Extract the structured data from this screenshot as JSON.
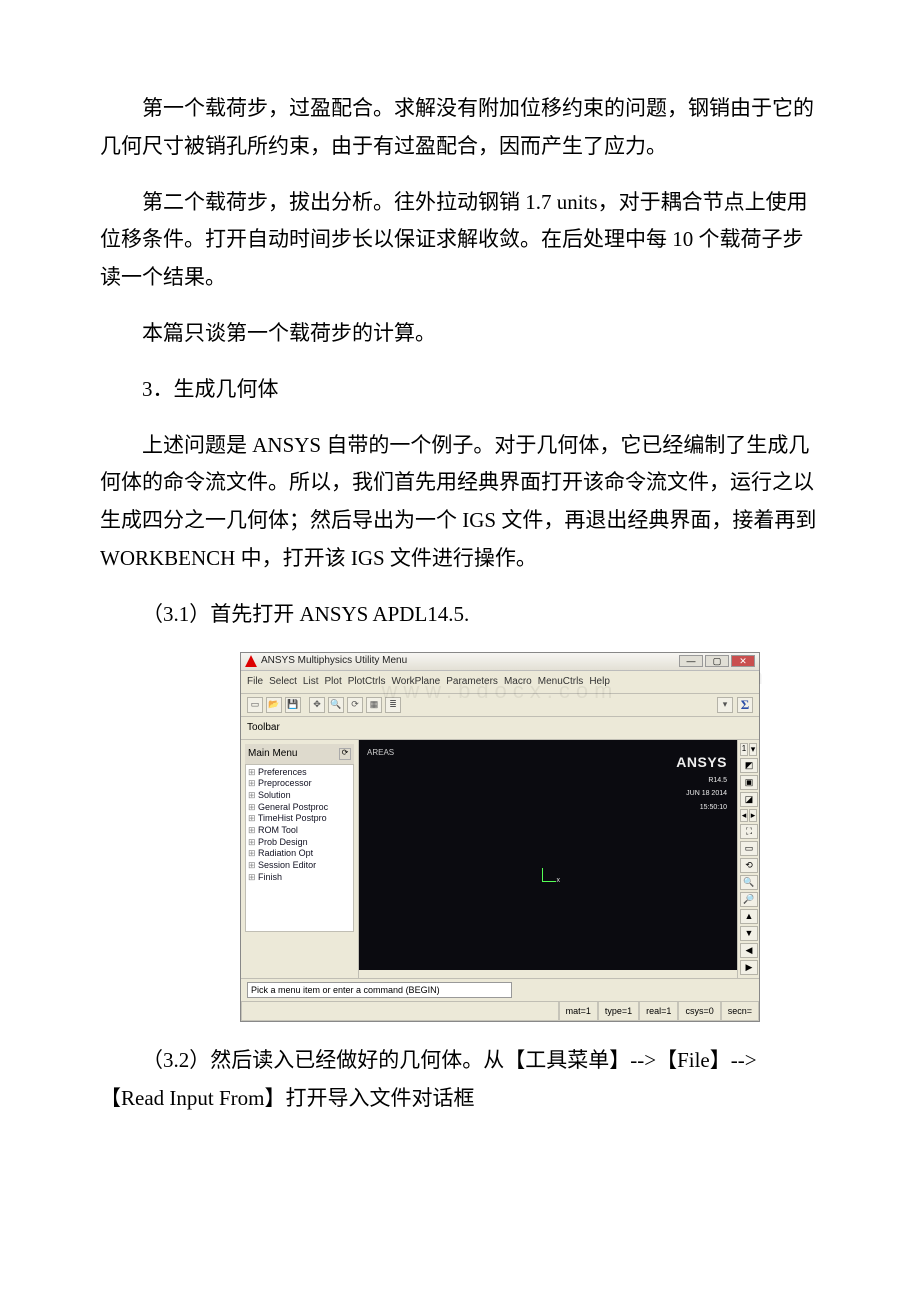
{
  "paragraphs": {
    "p1": "第一个载荷步，过盈配合。求解没有附加位移约束的问题，钢销由于它的几何尺寸被销孔所约束，由于有过盈配合，因而产生了应力。",
    "p2": "第二个载荷步，拔出分析。往外拉动钢销 1.7 units，对于耦合节点上使用位移条件。打开自动时间步长以保证求解收敛。在后处理中每 10 个载荷子步读一个结果。",
    "p3": "本篇只谈第一个载荷步的计算。",
    "p4": "3．生成几何体",
    "p5": "上述问题是 ANSYS 自带的一个例子。对于几何体，它已经编制了生成几何体的命令流文件。所以，我们首先用经典界面打开该命令流文件，运行之以生成四分之一几何体；然后导出为一个 IGS 文件，再退出经典界面，接着再到 WORKBENCH 中，打开该 IGS 文件进行操作。",
    "p6": "（3.1）首先打开 ANSYS APDL14.5.",
    "p7": "（3.2）然后读入已经做好的几何体。从【工具菜单】-->【File】-->【Read Input From】打开导入文件对话框"
  },
  "screenshot": {
    "title": "ANSYS Multiphysics Utility Menu",
    "menubar": [
      "File",
      "Select",
      "List",
      "Plot",
      "PlotCtrls",
      "WorkPlane",
      "Parameters",
      "Macro",
      "MenuCtrls",
      "Help"
    ],
    "toolbar_label": "Toolbar",
    "mainmenu_label": "Main Menu",
    "mainmenu_items": [
      "Preferences",
      "Preprocessor",
      "Solution",
      "General Postproc",
      "TimeHist Postpro",
      "ROM Tool",
      "Prob Design",
      "Radiation Opt",
      "Session Editor",
      "Finish"
    ],
    "gfx_brand": "ANSYS",
    "gfx_release": "R14.5",
    "gfx_date1": "JUN 18 2014",
    "gfx_date2": "15:50:10",
    "gfx_label": "AREAS",
    "cmd_placeholder": "Pick a menu item or enter a command (BEGIN)",
    "status": {
      "mat": "mat=1",
      "type": "type=1",
      "real": "real=1",
      "csys": "csys=0",
      "secn": "secn="
    },
    "watermark": "www.bdocx.com",
    "watermark_right": "m"
  }
}
